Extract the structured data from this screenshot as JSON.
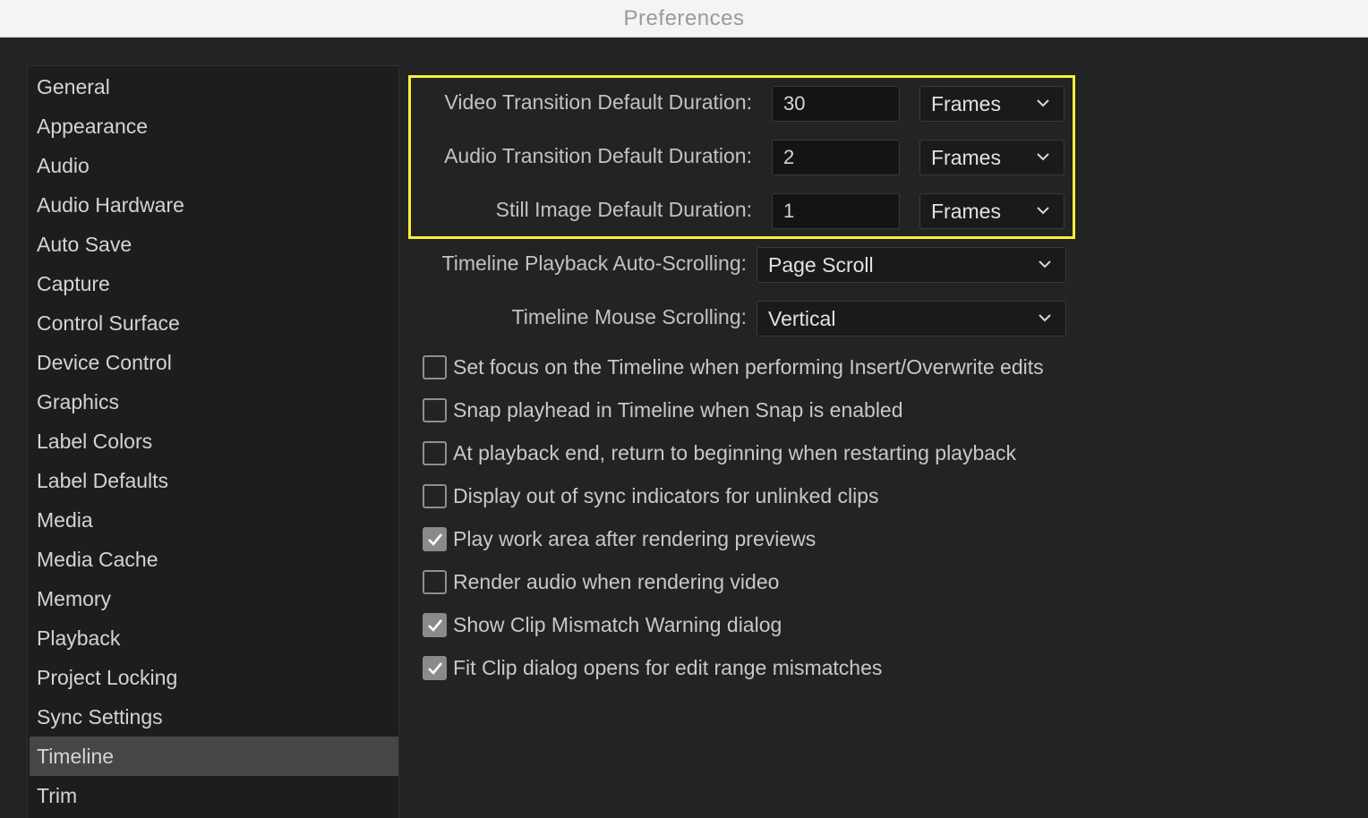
{
  "window": {
    "title": "Preferences"
  },
  "sidebar": {
    "items": [
      {
        "label": "General"
      },
      {
        "label": "Appearance"
      },
      {
        "label": "Audio"
      },
      {
        "label": "Audio Hardware"
      },
      {
        "label": "Auto Save"
      },
      {
        "label": "Capture"
      },
      {
        "label": "Control Surface"
      },
      {
        "label": "Device Control"
      },
      {
        "label": "Graphics"
      },
      {
        "label": "Label Colors"
      },
      {
        "label": "Label Defaults"
      },
      {
        "label": "Media"
      },
      {
        "label": "Media Cache"
      },
      {
        "label": "Memory"
      },
      {
        "label": "Playback"
      },
      {
        "label": "Project Locking"
      },
      {
        "label": "Sync Settings"
      },
      {
        "label": "Timeline"
      },
      {
        "label": "Trim"
      }
    ],
    "selected": "Timeline"
  },
  "durations": {
    "video": {
      "label": "Video Transition Default Duration:",
      "value": "30",
      "unit": "Frames"
    },
    "audio": {
      "label": "Audio Transition Default Duration:",
      "value": "2",
      "unit": "Frames"
    },
    "still": {
      "label": "Still Image Default Duration:",
      "value": "1",
      "unit": "Frames"
    }
  },
  "scrolling": {
    "playback": {
      "label": "Timeline Playback Auto-Scrolling:",
      "value": "Page Scroll"
    },
    "mouse": {
      "label": "Timeline Mouse Scrolling:",
      "value": "Vertical"
    }
  },
  "options": [
    {
      "label": "Set focus on the Timeline when performing Insert/Overwrite edits",
      "checked": false
    },
    {
      "label": "Snap playhead in Timeline when Snap is enabled",
      "checked": false
    },
    {
      "label": "At playback end, return to beginning when restarting playback",
      "checked": false
    },
    {
      "label": "Display out of sync indicators for unlinked clips",
      "checked": false
    },
    {
      "label": "Play work area after rendering previews",
      "checked": true
    },
    {
      "label": "Render audio when rendering video",
      "checked": false
    },
    {
      "label": "Show Clip Mismatch Warning dialog",
      "checked": true
    },
    {
      "label": "Fit Clip dialog opens for edit range mismatches",
      "checked": true
    }
  ],
  "colors": {
    "highlight": "#f6f03c",
    "background": "#232323",
    "selected_item": "#464646"
  },
  "icons": {
    "dropdown": "chevron-down-icon",
    "check": "checkmark-icon"
  }
}
